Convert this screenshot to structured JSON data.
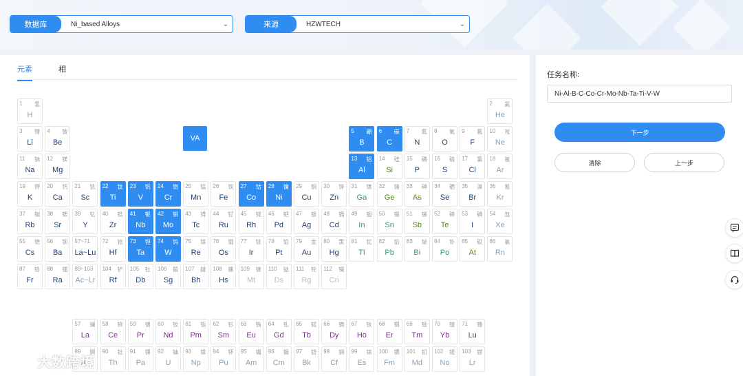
{
  "header": {
    "database_label": "数据库",
    "database_value": "Ni_based Alloys",
    "source_label": "来源",
    "source_value": "HZWTECH"
  },
  "tabs": [
    {
      "label": "元素",
      "active": true
    },
    {
      "label": "相",
      "active": false
    }
  ],
  "group_button": "VA",
  "colors": {
    "accent": "#2f8cf0",
    "lanthanide": "#7a2e8c",
    "metalloid": "#2e9b63",
    "nonmetal": "#4f8a10",
    "noble": "#8aa0b4",
    "default": "#1e3f73",
    "disabled": "#b8bcc2"
  },
  "elements": [
    {
      "n": "1",
      "cn": "氢",
      "s": "H",
      "r": 1,
      "c": 1,
      "cat": "noble"
    },
    {
      "n": "2",
      "cn": "氦",
      "s": "He",
      "r": 1,
      "c": 18,
      "cat": "noble"
    },
    {
      "n": "3",
      "cn": "锂",
      "s": "Li",
      "r": 2,
      "c": 1,
      "cat": "default"
    },
    {
      "n": "4",
      "cn": "铍",
      "s": "Be",
      "r": 2,
      "c": 2,
      "cat": "default"
    },
    {
      "n": "5",
      "cn": "硼",
      "s": "B",
      "r": 2,
      "c": 13,
      "cat": "default",
      "sel": true
    },
    {
      "n": "6",
      "cn": "碳",
      "s": "C",
      "r": 2,
      "c": 14,
      "cat": "default",
      "sel": true
    },
    {
      "n": "7",
      "cn": "氮",
      "s": "N",
      "r": 2,
      "c": 15,
      "cat": "default"
    },
    {
      "n": "8",
      "cn": "氧",
      "s": "O",
      "r": 2,
      "c": 16,
      "cat": "default"
    },
    {
      "n": "9",
      "cn": "氟",
      "s": "F",
      "r": 2,
      "c": 17,
      "cat": "default"
    },
    {
      "n": "10",
      "cn": "氖",
      "s": "Ne",
      "r": 2,
      "c": 18,
      "cat": "noble"
    },
    {
      "n": "11",
      "cn": "钠",
      "s": "Na",
      "r": 3,
      "c": 1,
      "cat": "default"
    },
    {
      "n": "12",
      "cn": "镁",
      "s": "Mg",
      "r": 3,
      "c": 2,
      "cat": "default"
    },
    {
      "n": "13",
      "cn": "铝",
      "s": "Al",
      "r": 3,
      "c": 13,
      "cat": "default",
      "sel": true
    },
    {
      "n": "14",
      "cn": "硅",
      "s": "Si",
      "r": 3,
      "c": 14,
      "cat": "nonmetal"
    },
    {
      "n": "15",
      "cn": "磷",
      "s": "P",
      "r": 3,
      "c": 15,
      "cat": "default"
    },
    {
      "n": "16",
      "cn": "硫",
      "s": "S",
      "r": 3,
      "c": 16,
      "cat": "default"
    },
    {
      "n": "17",
      "cn": "氯",
      "s": "Cl",
      "r": 3,
      "c": 17,
      "cat": "default"
    },
    {
      "n": "18",
      "cn": "氩",
      "s": "Ar",
      "r": 3,
      "c": 18,
      "cat": "noble"
    },
    {
      "n": "19",
      "cn": "钾",
      "s": "K",
      "r": 4,
      "c": 1,
      "cat": "default"
    },
    {
      "n": "20",
      "cn": "钙",
      "s": "Ca",
      "r": 4,
      "c": 2,
      "cat": "default"
    },
    {
      "n": "21",
      "cn": "钪",
      "s": "Sc",
      "r": 4,
      "c": 3,
      "cat": "default"
    },
    {
      "n": "22",
      "cn": "钛",
      "s": "Ti",
      "r": 4,
      "c": 4,
      "cat": "default",
      "sel": true
    },
    {
      "n": "23",
      "cn": "钒",
      "s": "V",
      "r": 4,
      "c": 5,
      "cat": "default",
      "sel": true
    },
    {
      "n": "24",
      "cn": "铬",
      "s": "Cr",
      "r": 4,
      "c": 6,
      "cat": "default",
      "sel": true
    },
    {
      "n": "25",
      "cn": "锰",
      "s": "Mn",
      "r": 4,
      "c": 7,
      "cat": "default"
    },
    {
      "n": "26",
      "cn": "铁",
      "s": "Fe",
      "r": 4,
      "c": 8,
      "cat": "default"
    },
    {
      "n": "27",
      "cn": "钴",
      "s": "Co",
      "r": 4,
      "c": 9,
      "cat": "default",
      "sel": true
    },
    {
      "n": "28",
      "cn": "镍",
      "s": "Ni",
      "r": 4,
      "c": 10,
      "cat": "default",
      "sel": true
    },
    {
      "n": "29",
      "cn": "铜",
      "s": "Cu",
      "r": 4,
      "c": 11,
      "cat": "default"
    },
    {
      "n": "30",
      "cn": "锌",
      "s": "Zn",
      "r": 4,
      "c": 12,
      "cat": "default"
    },
    {
      "n": "31",
      "cn": "镓",
      "s": "Ga",
      "r": 4,
      "c": 13,
      "cat": "metalloid"
    },
    {
      "n": "32",
      "cn": "锗",
      "s": "Ge",
      "r": 4,
      "c": 14,
      "cat": "nonmetal"
    },
    {
      "n": "33",
      "cn": "砷",
      "s": "As",
      "r": 4,
      "c": 15,
      "cat": "nonmetal"
    },
    {
      "n": "34",
      "cn": "硒",
      "s": "Se",
      "r": 4,
      "c": 16,
      "cat": "default"
    },
    {
      "n": "35",
      "cn": "溴",
      "s": "Br",
      "r": 4,
      "c": 17,
      "cat": "default"
    },
    {
      "n": "36",
      "cn": "氪",
      "s": "Kr",
      "r": 4,
      "c": 18,
      "cat": "noble"
    },
    {
      "n": "37",
      "cn": "铷",
      "s": "Rb",
      "r": 5,
      "c": 1,
      "cat": "default"
    },
    {
      "n": "38",
      "cn": "锶",
      "s": "Sr",
      "r": 5,
      "c": 2,
      "cat": "default"
    },
    {
      "n": "39",
      "cn": "钇",
      "s": "Y",
      "r": 5,
      "c": 3,
      "cat": "default"
    },
    {
      "n": "40",
      "cn": "锆",
      "s": "Zr",
      "r": 5,
      "c": 4,
      "cat": "default"
    },
    {
      "n": "41",
      "cn": "铌",
      "s": "Nb",
      "r": 5,
      "c": 5,
      "cat": "default",
      "sel": true
    },
    {
      "n": "42",
      "cn": "钼",
      "s": "Mo",
      "r": 5,
      "c": 6,
      "cat": "default",
      "sel": true
    },
    {
      "n": "43",
      "cn": "锝",
      "s": "Tc",
      "r": 5,
      "c": 7,
      "cat": "default"
    },
    {
      "n": "44",
      "cn": "钌",
      "s": "Ru",
      "r": 5,
      "c": 8,
      "cat": "default"
    },
    {
      "n": "45",
      "cn": "铑",
      "s": "Rh",
      "r": 5,
      "c": 9,
      "cat": "default"
    },
    {
      "n": "46",
      "cn": "钯",
      "s": "Pd",
      "r": 5,
      "c": 10,
      "cat": "default"
    },
    {
      "n": "47",
      "cn": "银",
      "s": "Ag",
      "r": 5,
      "c": 11,
      "cat": "default"
    },
    {
      "n": "48",
      "cn": "镉",
      "s": "Cd",
      "r": 5,
      "c": 12,
      "cat": "default"
    },
    {
      "n": "49",
      "cn": "铟",
      "s": "In",
      "r": 5,
      "c": 13,
      "cat": "metalloid"
    },
    {
      "n": "50",
      "cn": "锡",
      "s": "Sn",
      "r": 5,
      "c": 14,
      "cat": "metalloid"
    },
    {
      "n": "51",
      "cn": "锑",
      "s": "Sb",
      "r": 5,
      "c": 15,
      "cat": "nonmetal"
    },
    {
      "n": "52",
      "cn": "碲",
      "s": "Te",
      "r": 5,
      "c": 16,
      "cat": "nonmetal"
    },
    {
      "n": "53",
      "cn": "碘",
      "s": "I",
      "r": 5,
      "c": 17,
      "cat": "default"
    },
    {
      "n": "54",
      "cn": "氙",
      "s": "Xe",
      "r": 5,
      "c": 18,
      "cat": "noble"
    },
    {
      "n": "55",
      "cn": "铯",
      "s": "Cs",
      "r": 6,
      "c": 1,
      "cat": "default"
    },
    {
      "n": "56",
      "cn": "钡",
      "s": "Ba",
      "r": 6,
      "c": 2,
      "cat": "default"
    },
    {
      "n": "57~71",
      "cn": "",
      "s": "La~Lu",
      "r": 6,
      "c": 3,
      "cat": "default"
    },
    {
      "n": "72",
      "cn": "铪",
      "s": "Hf",
      "r": 6,
      "c": 4,
      "cat": "default"
    },
    {
      "n": "73",
      "cn": "钽",
      "s": "Ta",
      "r": 6,
      "c": 5,
      "cat": "default",
      "sel": true
    },
    {
      "n": "74",
      "cn": "钨",
      "s": "W",
      "r": 6,
      "c": 6,
      "cat": "default",
      "sel": true
    },
    {
      "n": "75",
      "cn": "铼",
      "s": "Re",
      "r": 6,
      "c": 7,
      "cat": "default"
    },
    {
      "n": "76",
      "cn": "锇",
      "s": "Os",
      "r": 6,
      "c": 8,
      "cat": "default"
    },
    {
      "n": "77",
      "cn": "铱",
      "s": "Ir",
      "r": 6,
      "c": 9,
      "cat": "default"
    },
    {
      "n": "78",
      "cn": "铂",
      "s": "Pt",
      "r": 6,
      "c": 10,
      "cat": "default"
    },
    {
      "n": "79",
      "cn": "金",
      "s": "Au",
      "r": 6,
      "c": 11,
      "cat": "default"
    },
    {
      "n": "80",
      "cn": "汞",
      "s": "Hg",
      "r": 6,
      "c": 12,
      "cat": "default"
    },
    {
      "n": "81",
      "cn": "铊",
      "s": "Tl",
      "r": 6,
      "c": 13,
      "cat": "metalloid"
    },
    {
      "n": "82",
      "cn": "铅",
      "s": "Pb",
      "r": 6,
      "c": 14,
      "cat": "metalloid"
    },
    {
      "n": "83",
      "cn": "铋",
      "s": "Bi",
      "r": 6,
      "c": 15,
      "cat": "metalloid"
    },
    {
      "n": "84",
      "cn": "钋",
      "s": "Po",
      "r": 6,
      "c": 16,
      "cat": "metalloid"
    },
    {
      "n": "85",
      "cn": "砹",
      "s": "At",
      "r": 6,
      "c": 17,
      "cat": "nonmetal"
    },
    {
      "n": "86",
      "cn": "氡",
      "s": "Rn",
      "r": 6,
      "c": 18,
      "cat": "noble"
    },
    {
      "n": "87",
      "cn": "钫",
      "s": "Fr",
      "r": 7,
      "c": 1,
      "cat": "default"
    },
    {
      "n": "88",
      "cn": "镭",
      "s": "Ra",
      "r": 7,
      "c": 2,
      "cat": "default"
    },
    {
      "n": "89~103",
      "cn": "",
      "s": "Ac~Lr",
      "r": 7,
      "c": 3,
      "cat": "noble"
    },
    {
      "n": "104",
      "cn": "铲",
      "s": "Rf",
      "r": 7,
      "c": 4,
      "cat": "default"
    },
    {
      "n": "105",
      "cn": "钍",
      "s": "Db",
      "r": 7,
      "c": 5,
      "cat": "default"
    },
    {
      "n": "106",
      "cn": "𨭎",
      "s": "Sg",
      "r": 7,
      "c": 6,
      "cat": "default"
    },
    {
      "n": "107",
      "cn": "𨨏",
      "s": "Bh",
      "r": 7,
      "c": 7,
      "cat": "default"
    },
    {
      "n": "108",
      "cn": "𨭆",
      "s": "Hs",
      "r": 7,
      "c": 8,
      "cat": "default"
    },
    {
      "n": "109",
      "cn": "鿏",
      "s": "Mt",
      "r": 7,
      "c": 9,
      "cat": "disabled"
    },
    {
      "n": "110",
      "cn": "𫟼",
      "s": "Ds",
      "r": 7,
      "c": 10,
      "cat": "disabled"
    },
    {
      "n": "111",
      "cn": "𬬭",
      "s": "Rg",
      "r": 7,
      "c": 11,
      "cat": "disabled"
    },
    {
      "n": "112",
      "cn": "鿔",
      "s": "Cn",
      "r": 7,
      "c": 12,
      "cat": "disabled"
    },
    {
      "n": "57",
      "cn": "镧",
      "s": "La",
      "r": 9,
      "c": 3,
      "cat": "lanthanide"
    },
    {
      "n": "58",
      "cn": "铈",
      "s": "Ce",
      "r": 9,
      "c": 4,
      "cat": "lanthanide"
    },
    {
      "n": "59",
      "cn": "镨",
      "s": "Pr",
      "r": 9,
      "c": 5,
      "cat": "lanthanide"
    },
    {
      "n": "60",
      "cn": "钕",
      "s": "Nd",
      "r": 9,
      "c": 6,
      "cat": "lanthanide"
    },
    {
      "n": "61",
      "cn": "钷",
      "s": "Pm",
      "r": 9,
      "c": 7,
      "cat": "lanthanide"
    },
    {
      "n": "62",
      "cn": "钐",
      "s": "Sm",
      "r": 9,
      "c": 8,
      "cat": "lanthanide"
    },
    {
      "n": "63",
      "cn": "铕",
      "s": "Eu",
      "r": 9,
      "c": 9,
      "cat": "lanthanide"
    },
    {
      "n": "64",
      "cn": "钆",
      "s": "Gd",
      "r": 9,
      "c": 10,
      "cat": "lanthanide"
    },
    {
      "n": "65",
      "cn": "铽",
      "s": "Tb",
      "r": 9,
      "c": 11,
      "cat": "lanthanide"
    },
    {
      "n": "66",
      "cn": "镝",
      "s": "Dy",
      "r": 9,
      "c": 12,
      "cat": "lanthanide"
    },
    {
      "n": "67",
      "cn": "钬",
      "s": "Ho",
      "r": 9,
      "c": 13,
      "cat": "lanthanide"
    },
    {
      "n": "68",
      "cn": "铒",
      "s": "Er",
      "r": 9,
      "c": 14,
      "cat": "lanthanide"
    },
    {
      "n": "69",
      "cn": "铥",
      "s": "Tm",
      "r": 9,
      "c": 15,
      "cat": "lanthanide"
    },
    {
      "n": "70",
      "cn": "镱",
      "s": "Yb",
      "r": 9,
      "c": 16,
      "cat": "lanthanide"
    },
    {
      "n": "71",
      "cn": "镥",
      "s": "Lu",
      "r": 9,
      "c": 17,
      "cat": "lanthanide"
    },
    {
      "n": "89",
      "cn": "锕",
      "s": "Ac",
      "r": 10,
      "c": 3,
      "cat": "noble"
    },
    {
      "n": "90",
      "cn": "钍",
      "s": "Th",
      "r": 10,
      "c": 4,
      "cat": "noble"
    },
    {
      "n": "91",
      "cn": "镤",
      "s": "Pa",
      "r": 10,
      "c": 5,
      "cat": "noble"
    },
    {
      "n": "92",
      "cn": "铀",
      "s": "U",
      "r": 10,
      "c": 6,
      "cat": "noble"
    },
    {
      "n": "93",
      "cn": "镎",
      "s": "Np",
      "r": 10,
      "c": 7,
      "cat": "noble"
    },
    {
      "n": "94",
      "cn": "钚",
      "s": "Pu",
      "r": 10,
      "c": 8,
      "cat": "noble"
    },
    {
      "n": "95",
      "cn": "镅",
      "s": "Am",
      "r": 10,
      "c": 9,
      "cat": "noble"
    },
    {
      "n": "96",
      "cn": "锔",
      "s": "Cm",
      "r": 10,
      "c": 10,
      "cat": "noble"
    },
    {
      "n": "97",
      "cn": "锫",
      "s": "Bk",
      "r": 10,
      "c": 11,
      "cat": "noble"
    },
    {
      "n": "98",
      "cn": "锎",
      "s": "Cf",
      "r": 10,
      "c": 12,
      "cat": "noble"
    },
    {
      "n": "99",
      "cn": "锿",
      "s": "Es",
      "r": 10,
      "c": 13,
      "cat": "noble"
    },
    {
      "n": "100",
      "cn": "镄",
      "s": "Fm",
      "r": 10,
      "c": 14,
      "cat": "noble"
    },
    {
      "n": "101",
      "cn": "钔",
      "s": "Md",
      "r": 10,
      "c": 15,
      "cat": "noble"
    },
    {
      "n": "102",
      "cn": "锘",
      "s": "No",
      "r": 10,
      "c": 16,
      "cat": "noble"
    },
    {
      "n": "103",
      "cn": "铹",
      "s": "Lr",
      "r": 10,
      "c": 17,
      "cat": "noble"
    }
  ],
  "side": {
    "task_label": "任务名称:",
    "task_value": "Ni-Al-B-C-Co-Cr-Mo-Nb-Ta-Ti-V-W",
    "next_button": "下一步",
    "clear_button": "清除",
    "prev_button": "上一步"
  },
  "floating_icons": [
    "chat-icon",
    "book-icon",
    "headset-icon"
  ],
  "watermark": {
    "text": "大数跨境"
  }
}
